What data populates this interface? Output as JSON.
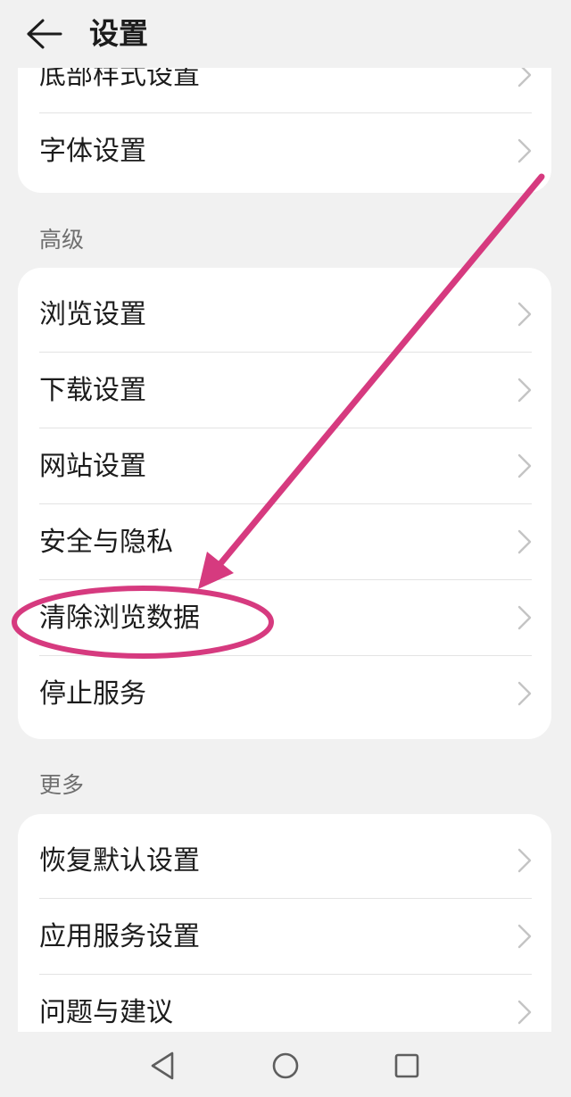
{
  "header": {
    "title": "设置"
  },
  "card_top": {
    "items": [
      {
        "label": "底部样式设置"
      },
      {
        "label": "字体设置"
      }
    ]
  },
  "section_advanced": {
    "title": "高级",
    "items": [
      {
        "label": "浏览设置"
      },
      {
        "label": "下载设置"
      },
      {
        "label": "网站设置"
      },
      {
        "label": "安全与隐私"
      },
      {
        "label": "清除浏览数据"
      },
      {
        "label": "停止服务"
      }
    ]
  },
  "section_more": {
    "title": "更多",
    "items": [
      {
        "label": "恢复默认设置"
      },
      {
        "label": "应用服务设置"
      },
      {
        "label": "问题与建议"
      }
    ]
  },
  "icons": {
    "back": "arrow-left-icon",
    "chevron": "chevron-right-icon",
    "nav_back": "triangle-back-icon",
    "nav_home": "circle-home-icon",
    "nav_recents": "square-recents-icon"
  },
  "colors": {
    "background": "#f1f1f1",
    "card": "#ffffff",
    "annotation": "#d63a7f",
    "chevron": "#c4c4c4"
  }
}
